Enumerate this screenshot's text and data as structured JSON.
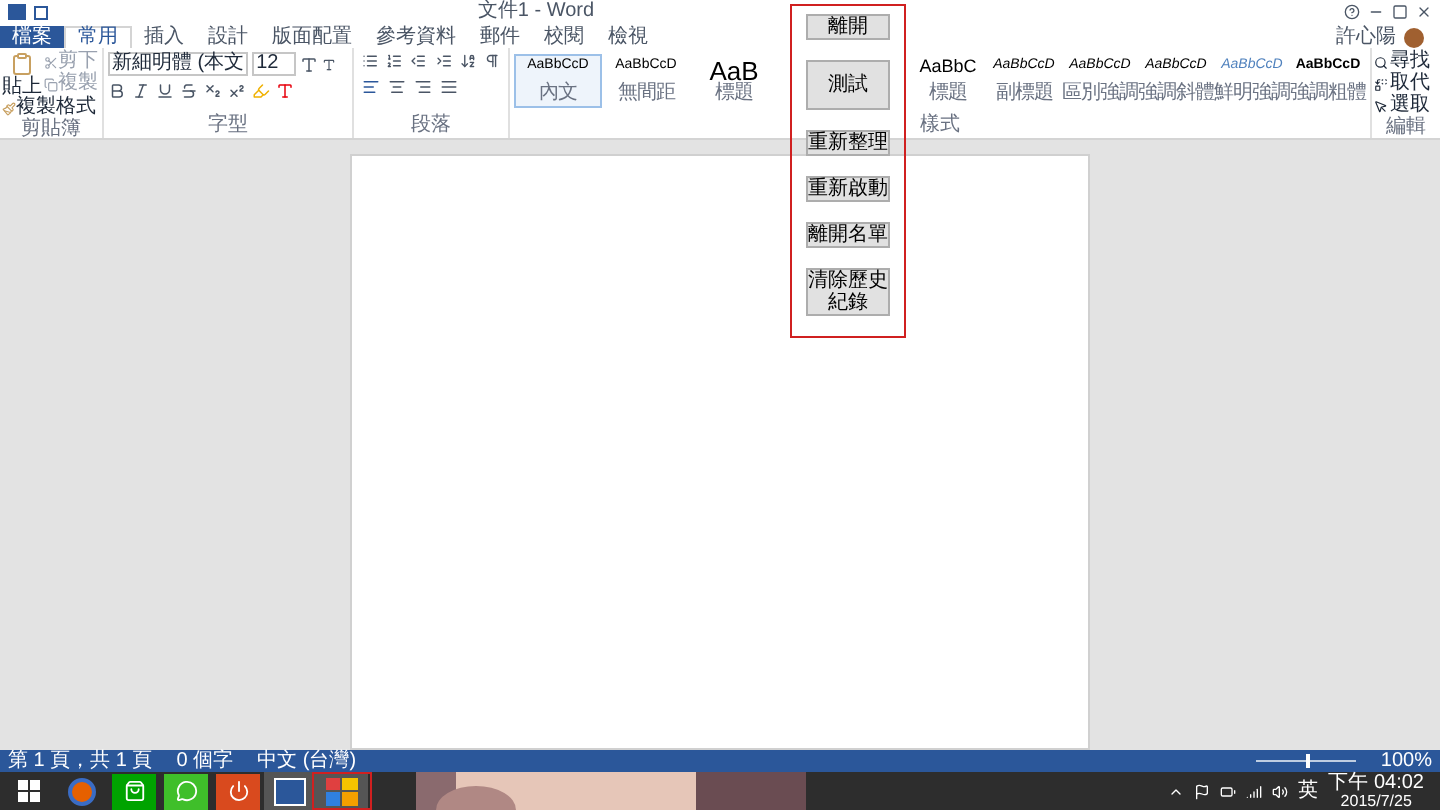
{
  "window": {
    "title": "文件1 - Word",
    "user": "許心陽"
  },
  "tabs": [
    {
      "label": "檔案",
      "kind": "file",
      "selected": false
    },
    {
      "label": "常用",
      "kind": "tab",
      "selected": true
    },
    {
      "label": "插入",
      "kind": "tab",
      "selected": false
    },
    {
      "label": "設計",
      "kind": "tab",
      "selected": false
    },
    {
      "label": "版面配置",
      "kind": "tab",
      "selected": false
    },
    {
      "label": "參考資料",
      "kind": "tab",
      "selected": false
    },
    {
      "label": "郵件",
      "kind": "tab",
      "selected": false
    },
    {
      "label": "校閱",
      "kind": "tab",
      "selected": false
    },
    {
      "label": "檢視",
      "kind": "tab",
      "selected": false
    }
  ],
  "clipboard": {
    "paste": "貼上",
    "cut": "剪下",
    "copy": "複製",
    "format_painter": "複製格式",
    "group": "剪貼簿"
  },
  "font": {
    "name": "新細明體 (本文",
    "size": "12",
    "group": "字型"
  },
  "paragraph": {
    "group": "段落"
  },
  "styles": {
    "group": "樣式",
    "items": [
      {
        "preview": "AaBbCcD",
        "label": "內文",
        "kind": "normal",
        "selected": true
      },
      {
        "preview": "AaBbCcD",
        "label": "無間距",
        "kind": "normal",
        "selected": false
      },
      {
        "preview": "AaB",
        "label": "標題",
        "kind": "heading",
        "selected": false
      },
      {
        "preview": "AaBbC",
        "label": "標題",
        "kind": "title",
        "selected": false
      },
      {
        "preview": "AaBbCcD",
        "label": "副標題",
        "kind": "italic",
        "selected": false
      },
      {
        "preview": "AaBbCcD",
        "label": "區別強調",
        "kind": "italic",
        "selected": false
      },
      {
        "preview": "AaBbCcD",
        "label": "強調斜體",
        "kind": "italic",
        "selected": false
      },
      {
        "preview": "AaBbCcD",
        "label": "鮮明強調",
        "kind": "accent",
        "selected": false
      },
      {
        "preview": "AaBbCcD",
        "label": "強調粗體",
        "kind": "bold",
        "selected": false
      }
    ]
  },
  "editing": {
    "group": "編輯",
    "find": "尋找",
    "replace": "取代",
    "select": "選取"
  },
  "panel": {
    "buttons": [
      "離開",
      "測試",
      "重新整理",
      "重新啟動",
      "離開名單",
      "清除歷史紀錄"
    ]
  },
  "status_bar": {
    "page": "第 1 頁，共 1 頁",
    "words": "0 個字",
    "language": "中文 (台灣)",
    "zoom": "100%",
    "zoom_slider": {
      "level": 0.5
    }
  },
  "taskbar": {
    "apps": [
      {
        "kind": "firefox",
        "selected": false
      },
      {
        "kind": "store",
        "selected": false
      },
      {
        "kind": "chat",
        "selected": false
      },
      {
        "kind": "power",
        "selected": false
      },
      {
        "kind": "word",
        "selected": true
      },
      {
        "kind": "tiles",
        "selected": true
      }
    ],
    "ime": "英",
    "time": "下午 04:02",
    "date": "2015/7/25"
  }
}
